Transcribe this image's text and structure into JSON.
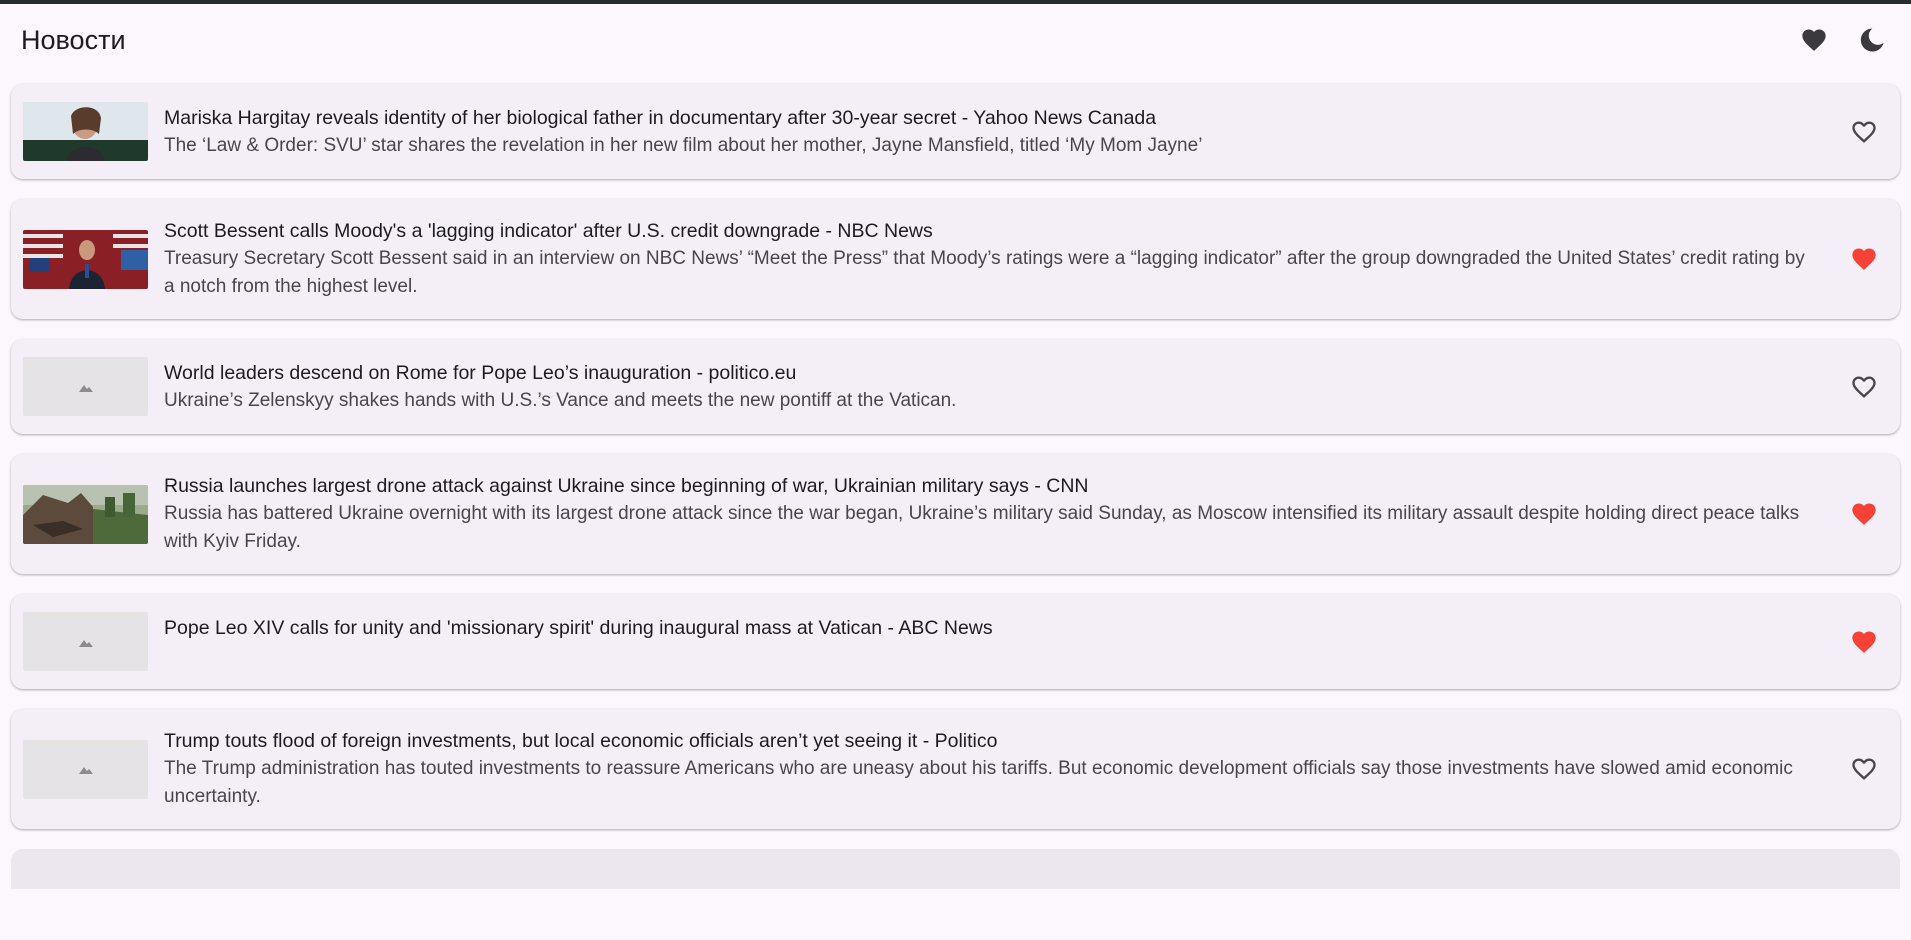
{
  "app": {
    "title": "Новости",
    "actions": [
      {
        "icon": "heart-filled-icon"
      },
      {
        "icon": "moon-icon"
      }
    ]
  },
  "colors": {
    "favorite_active": "#f44336",
    "favorite_inactive": "#49454f",
    "card_bg": "#f4eff6"
  },
  "articles": [
    {
      "title": "Mariska Hargitay reveals identity of her biological father in documentary after 30-year secret - Yahoo News Canada",
      "description": "The ‘Law & Order: SVU’ star shares the revelation in her new film about her mother, Jayne Mansfield, titled ‘My Mom Jayne’",
      "image": "photo",
      "favorite": false
    },
    {
      "title": "Scott Bessent calls Moody's a 'lagging indicator' after U.S. credit downgrade - NBC News",
      "description": "Treasury Secretary Scott Bessent said in an interview on NBC News’ “Meet the Press” that Moody’s ratings were a “lagging indicator” after the group downgraded the United States’ credit rating by a notch from the highest level.",
      "image": "photo",
      "favorite": true
    },
    {
      "title": "World leaders descend on Rome for Pope Leo’s inauguration - politico.eu",
      "description": "Ukraine’s Zelenskyy shakes hands with U.S.’s Vance and meets the new pontiff at the Vatican.",
      "image": "placeholder",
      "favorite": false
    },
    {
      "title": "Russia launches largest drone attack against Ukraine since beginning of war, Ukrainian military says - CNN",
      "description": "Russia has battered Ukraine overnight with its largest drone attack since the war began, Ukraine’s military said Sunday, as Moscow intensified its military assault despite holding direct peace talks with Kyiv Friday.",
      "image": "photo",
      "favorite": true
    },
    {
      "title": "Pope Leo XIV calls for unity and 'missionary spirit' during inaugural mass at Vatican - ABC News",
      "description": "",
      "image": "placeholder",
      "favorite": true
    },
    {
      "title": "Trump touts flood of foreign investments, but local economic officials aren’t yet seeing it - Politico",
      "description": "The Trump administration has touted investments to reassure Americans who are uneasy about his tariffs. But economic development officials say those investments have slowed amid economic uncertainty.",
      "image": "placeholder",
      "favorite": false
    }
  ]
}
